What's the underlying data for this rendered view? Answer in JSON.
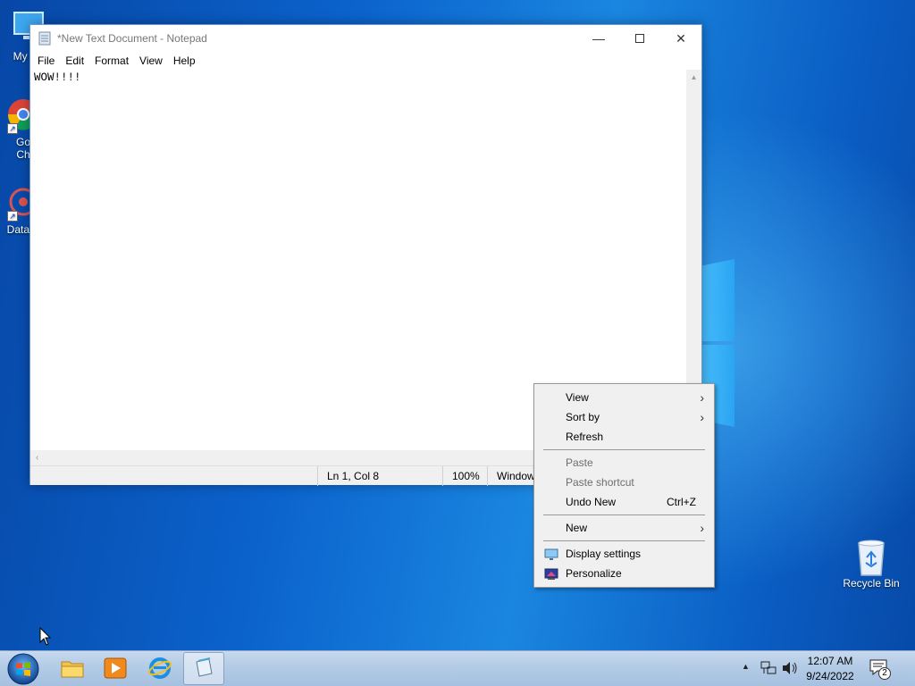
{
  "desktop": {
    "icons": [
      {
        "label": "My Co",
        "icon": "computer-icon"
      },
      {
        "label": "Go\nCh",
        "icon": "chrome-icon"
      },
      {
        "label": "DataW",
        "icon": "datawrapper-icon"
      }
    ],
    "recycle_bin": {
      "label": "Recycle Bin",
      "icon": "recycle-bin-icon"
    }
  },
  "notepad": {
    "title": "*New Text Document - Notepad",
    "menu": [
      "File",
      "Edit",
      "Format",
      "View",
      "Help"
    ],
    "content": "WOW!!!!",
    "status": {
      "position": "Ln 1, Col 8",
      "zoom": "100%",
      "line_ending": "Window"
    }
  },
  "context_menu": {
    "items": [
      {
        "label": "View",
        "submenu": true,
        "enabled": true
      },
      {
        "label": "Sort by",
        "submenu": true,
        "enabled": true
      },
      {
        "label": "Refresh",
        "enabled": true
      },
      {
        "label": "Paste",
        "enabled": false
      },
      {
        "label": "Paste shortcut",
        "enabled": false
      },
      {
        "label": "Undo New",
        "accelerator": "Ctrl+Z",
        "enabled": true
      },
      {
        "label": "New",
        "submenu": true,
        "enabled": true
      },
      {
        "label": "Display settings",
        "icon": "display-settings-icon",
        "enabled": true
      },
      {
        "label": "Personalize",
        "icon": "personalize-icon",
        "enabled": true
      }
    ]
  },
  "taskbar": {
    "pinned": [
      "file-explorer-icon",
      "media-player-icon",
      "internet-explorer-icon",
      "notepad-icon"
    ],
    "tray": {
      "time": "12:07 AM",
      "date": "9/24/2022",
      "notification_count": "2"
    }
  },
  "colors": {
    "desktop_blue": "#0b63cc",
    "taskbar": "#b3cbe6",
    "menu_bg": "#f0f0f0"
  }
}
